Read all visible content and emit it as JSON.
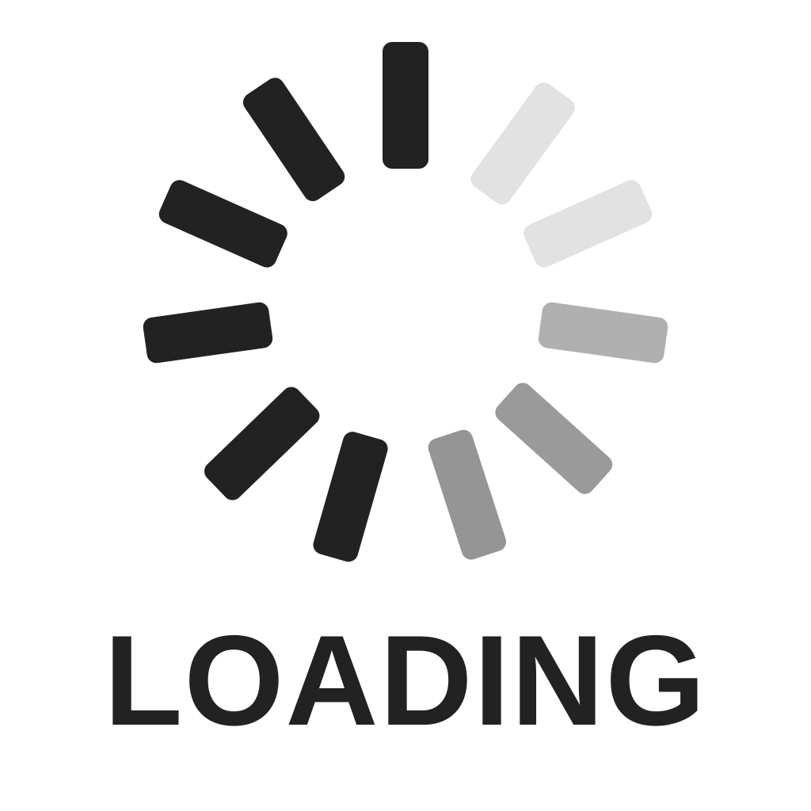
{
  "spinner": {
    "icon": "loading-spinner-icon",
    "segments": [
      {
        "angle": 0,
        "color": "#222222"
      },
      {
        "angle": 36,
        "color": "#e2e2e2"
      },
      {
        "angle": 66,
        "color": "#e2e2e2"
      },
      {
        "angle": 98,
        "color": "#b0b0b0"
      },
      {
        "angle": 132,
        "color": "#9a9a9a"
      },
      {
        "angle": 162,
        "color": "#959595"
      },
      {
        "angle": 196,
        "color": "#222222"
      },
      {
        "angle": 226,
        "color": "#222222"
      },
      {
        "angle": 262,
        "color": "#222222"
      },
      {
        "angle": 294,
        "color": "#222222"
      },
      {
        "angle": 326,
        "color": "#222222"
      }
    ]
  },
  "label": {
    "text": "LOADING",
    "color": "#222222"
  }
}
